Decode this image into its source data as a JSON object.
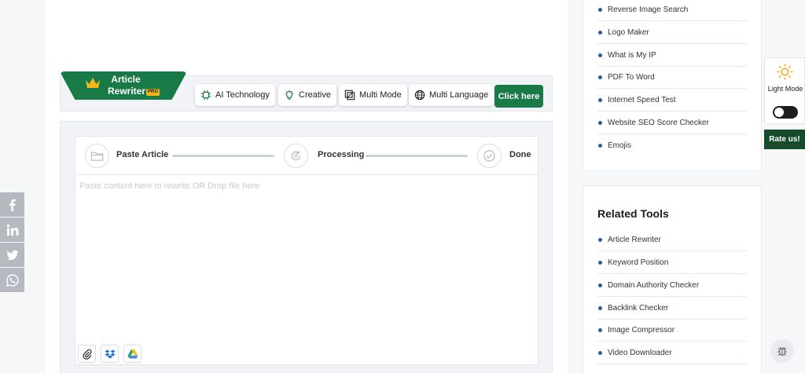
{
  "tool": {
    "brand_title": "Article Rewriter",
    "pro_badge": "PRO",
    "features": [
      {
        "label": "AI Technology",
        "icon": "chip-icon"
      },
      {
        "label": "Creative",
        "icon": "lightbulb-icon"
      },
      {
        "label": "Multi Mode",
        "icon": "layers-icon"
      },
      {
        "label": "Multi Language",
        "icon": "globe-icon"
      }
    ],
    "cta_label": "Click here",
    "accent": "#187a47"
  },
  "editor": {
    "steps": [
      {
        "label": "Paste Article",
        "icon": "folder-icon"
      },
      {
        "label": "Processing",
        "icon": "refresh-icon"
      },
      {
        "label": "Done",
        "icon": "check-circle-icon"
      }
    ],
    "placeholder": "Paste content here to rewrite OR Drop file here",
    "upload_sources": [
      "paperclip-icon",
      "dropbox-icon",
      "google-drive-icon"
    ]
  },
  "sidebar": {
    "top_list": [
      "Reverse Image Search",
      "Logo Maker",
      "What is My IP",
      "PDF To Word",
      "Internet Speed Test",
      "Website SEO Score Checker",
      "Emojis"
    ],
    "related_heading": "Related Tools",
    "related_list": [
      "Article Rewriter",
      "Keyword Position",
      "Domain Authority Checker",
      "Backlink Checker",
      "Image Compressor",
      "Video Downloader"
    ]
  },
  "theme_widget": {
    "label": "Light Mode",
    "rate_label": "Rate us!"
  },
  "social": [
    "facebook-icon",
    "linkedin-icon",
    "twitter-icon",
    "whatsapp-icon"
  ]
}
